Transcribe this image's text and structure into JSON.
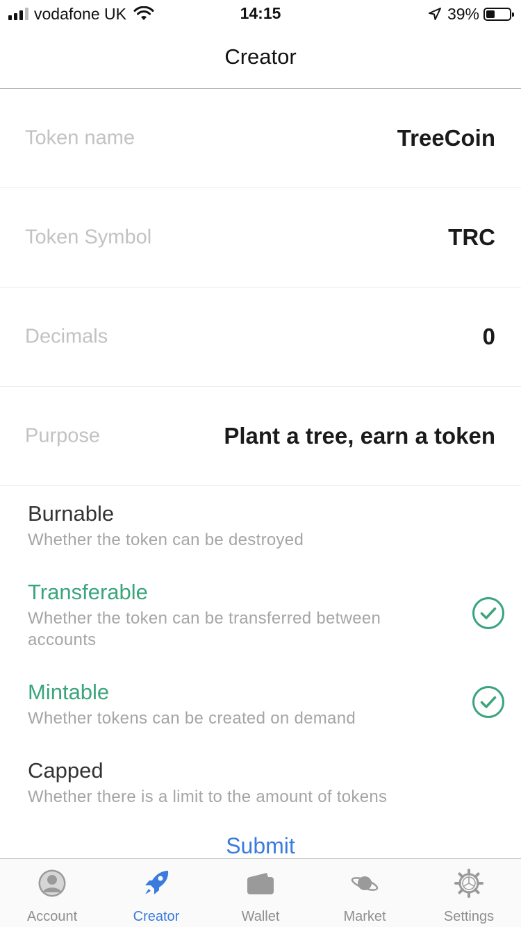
{
  "status_bar": {
    "carrier": "vodafone UK",
    "time": "14:15",
    "battery": "39%",
    "battery_level": 0.39
  },
  "nav": {
    "title": "Creator"
  },
  "form": {
    "fields": [
      {
        "label": "Token name",
        "value": "TreeCoin"
      },
      {
        "label": "Token Symbol",
        "value": "TRC"
      },
      {
        "label": "Decimals",
        "value": "0"
      },
      {
        "label": "Purpose",
        "value": "Plant a tree, earn a token"
      }
    ]
  },
  "options": [
    {
      "title": "Burnable",
      "description": "Whether the token can be destroyed",
      "checked": false
    },
    {
      "title": "Transferable",
      "description": "Whether the token can be transferred between accounts",
      "checked": true
    },
    {
      "title": "Mintable",
      "description": "Whether tokens can be created on demand",
      "checked": true
    },
    {
      "title": "Capped",
      "description": "Whether there is a limit to the amount of tokens",
      "checked": false
    }
  ],
  "submit_label": "Submit",
  "tabs": [
    {
      "label": "Account",
      "icon": "account-icon",
      "active": false
    },
    {
      "label": "Creator",
      "icon": "rocket-icon",
      "active": true
    },
    {
      "label": "Wallet",
      "icon": "wallet-icon",
      "active": false
    },
    {
      "label": "Market",
      "icon": "planet-icon",
      "active": false
    },
    {
      "label": "Settings",
      "icon": "gear-icon",
      "active": false
    }
  ],
  "colors": {
    "accent_blue": "#3a7bdc",
    "enabled_green": "#3aa57c",
    "placeholder_gray": "#c2c2c2",
    "description_gray": "#a5a5a5"
  }
}
